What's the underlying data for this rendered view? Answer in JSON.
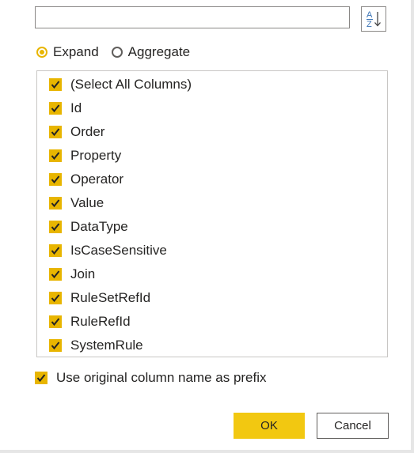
{
  "search": {
    "value": "",
    "placeholder": ""
  },
  "sort_button": {
    "icon": "sort-az-icon",
    "glyph_top": "A",
    "glyph_bottom": "Z"
  },
  "mode": {
    "selected": "expand",
    "options": [
      {
        "id": "expand",
        "label": "Expand",
        "checked": true
      },
      {
        "id": "aggregate",
        "label": "Aggregate",
        "checked": false
      }
    ]
  },
  "columns": [
    {
      "label": "(Select All Columns)",
      "checked": true
    },
    {
      "label": "Id",
      "checked": true
    },
    {
      "label": "Order",
      "checked": true
    },
    {
      "label": "Property",
      "checked": true
    },
    {
      "label": "Operator",
      "checked": true
    },
    {
      "label": "Value",
      "checked": true
    },
    {
      "label": "DataType",
      "checked": true
    },
    {
      "label": "IsCaseSensitive",
      "checked": true
    },
    {
      "label": "Join",
      "checked": true
    },
    {
      "label": "RuleSetRefId",
      "checked": true
    },
    {
      "label": "RuleRefId",
      "checked": true
    },
    {
      "label": "SystemRule",
      "checked": true
    }
  ],
  "prefix_option": {
    "label": "Use original column name as prefix",
    "checked": true
  },
  "buttons": {
    "ok": "OK",
    "cancel": "Cancel"
  },
  "colors": {
    "accent": "#f2c811",
    "checkbox": "#e8b500",
    "border": "#8a8886"
  }
}
